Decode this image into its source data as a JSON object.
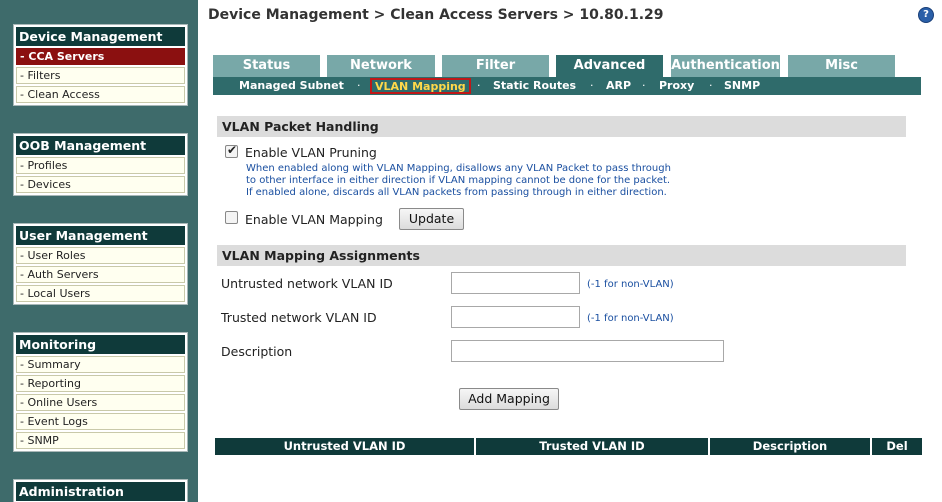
{
  "sidebar": {
    "groups": [
      {
        "title": "Device Management",
        "items": [
          "- CCA Servers",
          "- Filters",
          "- Clean Access"
        ],
        "active_index": 0
      },
      {
        "title": "OOB Management",
        "items": [
          "- Profiles",
          "- Devices"
        ]
      },
      {
        "title": "User Management",
        "items": [
          "- User Roles",
          "- Auth Servers",
          "- Local Users"
        ]
      },
      {
        "title": "Monitoring",
        "items": [
          "- Summary",
          "- Reporting",
          "- Online Users",
          "- Event Logs",
          "- SNMP"
        ]
      },
      {
        "title": "Administration",
        "items": []
      }
    ]
  },
  "header": {
    "title": "Device Management > Clean Access Servers > 10.80.1.29",
    "help_icon": "help-circle-icon"
  },
  "tabs": [
    "Status",
    "Network",
    "Filter",
    "Advanced",
    "Authentication",
    "Misc"
  ],
  "active_tab": "Advanced",
  "subtabs": [
    "Managed Subnet",
    "VLAN Mapping",
    "Static Routes",
    "ARP",
    "Proxy",
    "SNMP"
  ],
  "active_subtab": "VLAN Mapping",
  "subtab_separator": "·",
  "packet_handling": {
    "title": "VLAN Packet Handling",
    "pruning_label": "Enable VLAN Pruning",
    "pruning_checked": true,
    "pruning_note": [
      "When enabled along with VLAN Mapping, disallows any VLAN Packet to pass through",
      "to other interface in either direction if VLAN mapping cannot be done for the packet.",
      "If enabled alone, discards all VLAN packets from passing through in either direction."
    ],
    "mapping_label": "Enable VLAN Mapping",
    "mapping_checked": false,
    "update_button": "Update"
  },
  "assignments": {
    "title": "VLAN Mapping Assignments",
    "untrusted_label": "Untrusted network VLAN ID",
    "untrusted_value": "",
    "untrusted_hint": "(-1 for non-VLAN)",
    "trusted_label": "Trusted network VLAN ID",
    "trusted_value": "",
    "trusted_hint": "(-1 for non-VLAN)",
    "description_label": "Description",
    "description_value": "",
    "add_button": "Add Mapping"
  },
  "table": {
    "columns": [
      "Untrusted VLAN ID",
      "Trusted VLAN ID",
      "Description",
      "Del"
    ]
  }
}
